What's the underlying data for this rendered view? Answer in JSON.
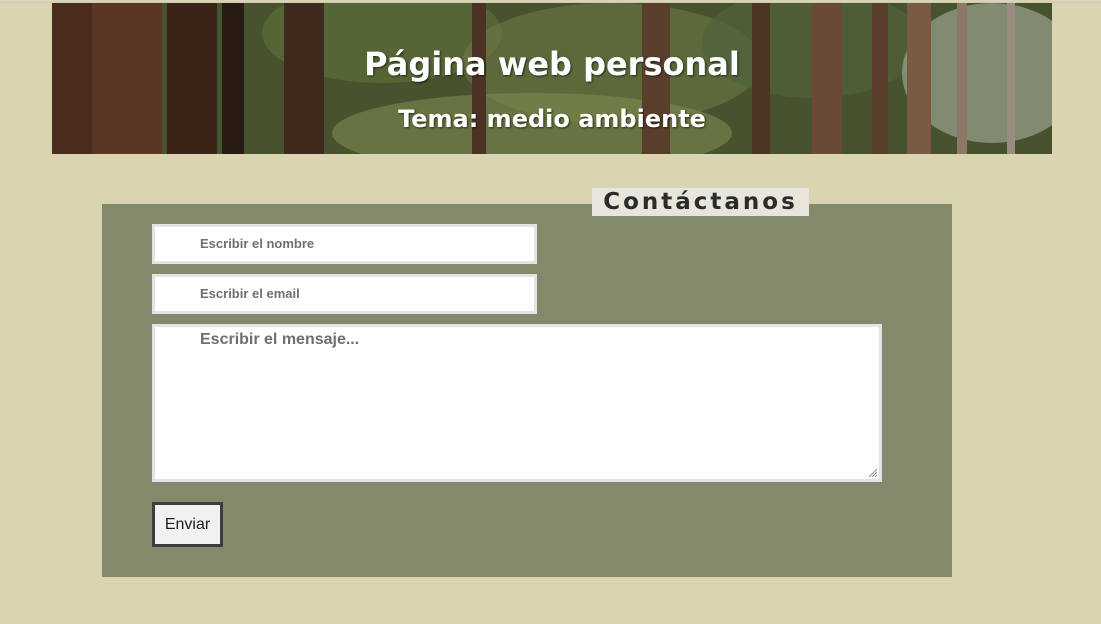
{
  "header": {
    "title": "Página web personal",
    "subtitle": "Tema: medio ambiente",
    "background": "forest-image"
  },
  "contact": {
    "legend": "Contáctanos",
    "name_placeholder": "Escribir el nombre",
    "email_placeholder": "Escribir el email",
    "message_placeholder": "Escribir el mensaje...",
    "submit_label": "Enviar"
  },
  "colors": {
    "page_background": "#dad5b0",
    "panel_background": "#83896b",
    "legend_background": "#e7e5dc"
  }
}
